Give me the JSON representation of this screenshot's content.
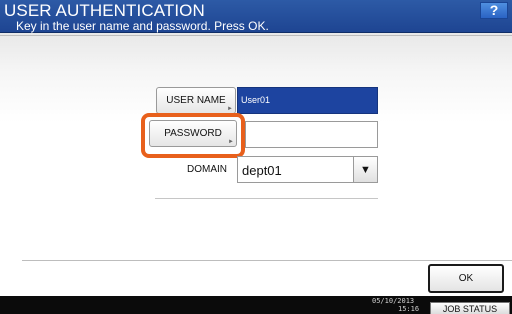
{
  "header": {
    "title": "USER AUTHENTICATION",
    "subtitle": "Key in the user name and password. Press OK.",
    "help_label": "?"
  },
  "form": {
    "user_name_label": "USER NAME",
    "user_name_value": "User01",
    "password_label": "PASSWORD",
    "password_value": "",
    "domain_label": "DOMAIN",
    "domain_value": "dept01",
    "corner_mark": "►",
    "dropdown_arrow": "▼"
  },
  "footer": {
    "ok_label": "OK",
    "date": "05/10/2013",
    "time": "15:16",
    "job_status_label": "JOB STATUS"
  },
  "colors": {
    "title_bar": "#1e4592",
    "selected_field": "#1d44a0",
    "highlight": "#e8601c"
  }
}
